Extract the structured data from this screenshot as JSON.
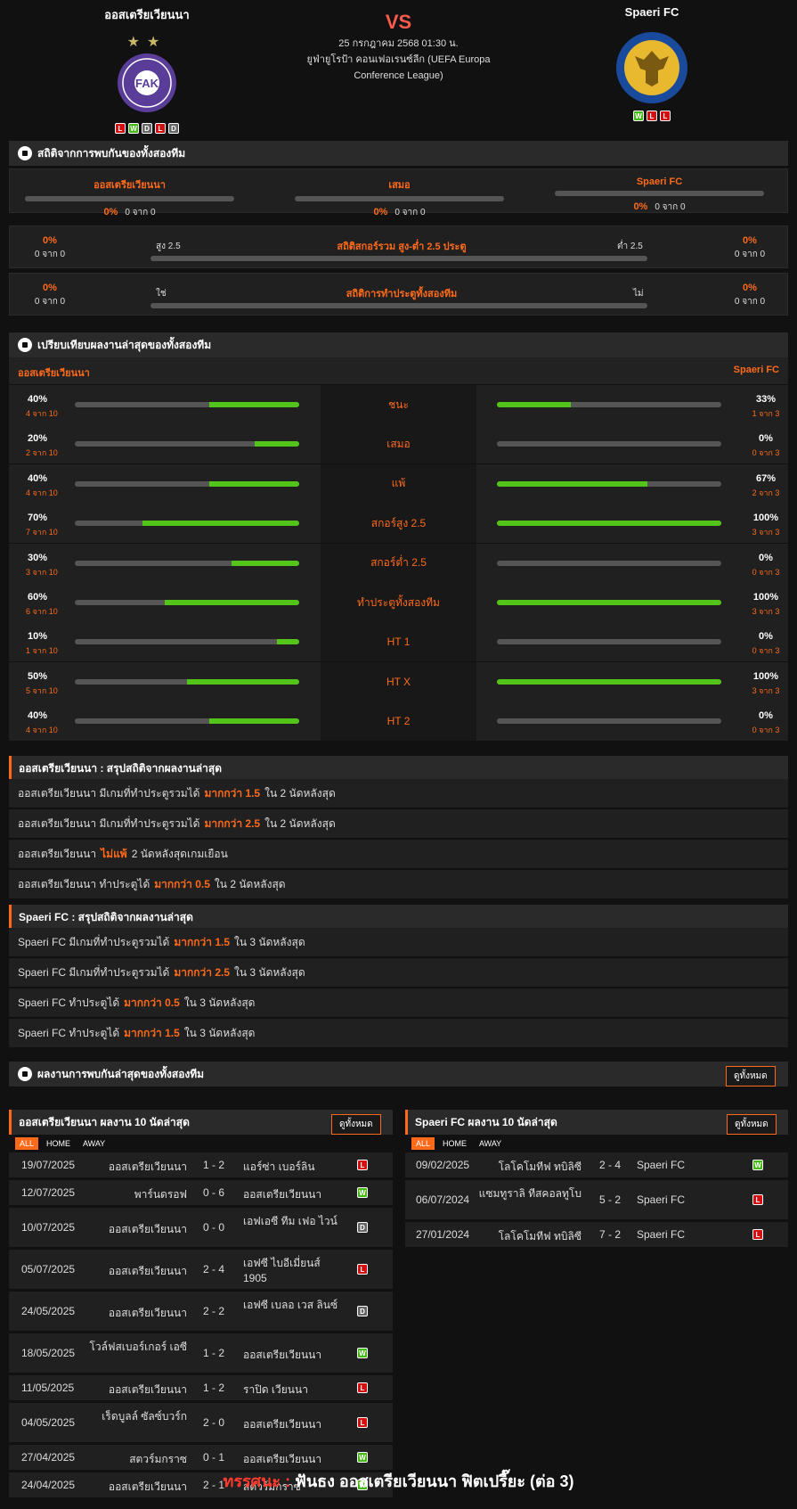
{
  "match": {
    "home": "ออสเตรียเวียนนา",
    "away": "Spaeri FC",
    "vs": "VS",
    "date": "25 กรกฎาคม 2568 01:30 น.",
    "competition": "ยูฟ่ายูโรป้า คอนเฟอเรนซ์ลีก (UEFA Europa Conference League)",
    "home_form": [
      "L",
      "W",
      "D",
      "L",
      "D"
    ],
    "away_form": [
      "W",
      "L",
      "L"
    ]
  },
  "h2h": {
    "title": "สถิติจากการพบกันของทั้งสองทีม",
    "cols": [
      {
        "label": "ออสเตรียเวียนนา",
        "pct": "0%",
        "of": "0 จาก 0"
      },
      {
        "label": "เสมอ",
        "pct": "0%",
        "of": "0 จาก 0"
      },
      {
        "label": "Spaeri FC",
        "pct": "0%",
        "of": "0 จาก 0"
      }
    ],
    "ou": {
      "title": "สถิติสกอร์รวม สูง-ต่ำ 2.5 ประตู",
      "left_label": "สูง 2.5",
      "right_label": "ต่ำ 2.5",
      "lp": "0%",
      "lo": "0 จาก 0",
      "rp": "0%",
      "ro": "0 จาก 0"
    },
    "btts": {
      "title": "สถิติการทำประตูทั้งสองทีม",
      "left_label": "ใช่",
      "right_label": "ไม่",
      "lp": "0%",
      "lo": "0 จาก 0",
      "rp": "0%",
      "ro": "0 จาก 0"
    }
  },
  "compare": {
    "title": "เปรียบเทียบผลงานล่าสุดของทั้งสองทีม",
    "home": "ออสเตรียเวียนนา",
    "away": "Spaeri FC",
    "rows": [
      {
        "label": "ชนะ",
        "hp": "40%",
        "ho": "4 จาก 10",
        "hv": 0.4,
        "ap": "33%",
        "ao": "1 จาก 3",
        "av": 0.33
      },
      {
        "label": "เสมอ",
        "hp": "20%",
        "ho": "2 จาก 10",
        "hv": 0.2,
        "ap": "0%",
        "ao": "0 จาก 3",
        "av": 0
      },
      {
        "label": "แพ้",
        "hp": "40%",
        "ho": "4 จาก 10",
        "hv": 0.4,
        "ap": "67%",
        "ao": "2 จาก 3",
        "av": 0.67
      },
      {
        "label": "สกอร์สูง 2.5",
        "hp": "70%",
        "ho": "7 จาก 10",
        "hv": 0.7,
        "ap": "100%",
        "ao": "3 จาก 3",
        "av": 1
      },
      {
        "label": "สกอร์ต่ำ 2.5",
        "hp": "30%",
        "ho": "3 จาก 10",
        "hv": 0.3,
        "ap": "0%",
        "ao": "0 จาก 3",
        "av": 0
      },
      {
        "label": "ทำประตูทั้งสองทีม",
        "hp": "60%",
        "ho": "6 จาก 10",
        "hv": 0.6,
        "ap": "100%",
        "ao": "3 จาก 3",
        "av": 1
      },
      {
        "label": "HT 1",
        "hp": "10%",
        "ho": "1 จาก 10",
        "hv": 0.1,
        "ap": "0%",
        "ao": "0 จาก 3",
        "av": 0
      },
      {
        "label": "HT X",
        "hp": "50%",
        "ho": "5 จาก 10",
        "hv": 0.5,
        "ap": "100%",
        "ao": "3 จาก 3",
        "av": 1
      },
      {
        "label": "HT 2",
        "hp": "40%",
        "ho": "4 จาก 10",
        "hv": 0.4,
        "ap": "0%",
        "ao": "0 จาก 3",
        "av": 0
      }
    ]
  },
  "summary_home": {
    "title": "ออสเตรียเวียนนา : สรุปสถิติจากผลงานล่าสุด",
    "rows": [
      {
        "a": "ออสเตรียเวียนนา  มีเกมที่ทำประตูรวมได้",
        "h": "มากกว่า  1.5",
        "b": "ใน 2 นัดหลังสุด"
      },
      {
        "a": "ออสเตรียเวียนนา  มีเกมที่ทำประตูรวมได้",
        "h": "มากกว่า  2.5",
        "b": "ใน 2 นัดหลังสุด"
      },
      {
        "a": "ออสเตรียเวียนนา",
        "h": "ไม่แพ้",
        "b": "2  นัดหลังสุดเกมเยือน"
      },
      {
        "a": "ออสเตรียเวียนนา  ทำประตูได้",
        "h": "มากกว่า  0.5",
        "b": "ใน 2 นัดหลังสุด"
      }
    ]
  },
  "summary_away": {
    "title": "Spaeri FC : สรุปสถิติจากผลงานล่าสุด",
    "rows": [
      {
        "a": "Spaeri FC  มีเกมที่ทำประตูรวมได้",
        "h": "มากกว่า  1.5",
        "b": "ใน 3 นัดหลังสุด"
      },
      {
        "a": "Spaeri FC  มีเกมที่ทำประตูรวมได้",
        "h": "มากกว่า  2.5",
        "b": "ใน 3 นัดหลังสุด"
      },
      {
        "a": "Spaeri FC  ทำประตูได้",
        "h": "มากกว่า  0.5",
        "b": "ใน 3 นัดหลังสุด"
      },
      {
        "a": "Spaeri FC  ทำประตูได้",
        "h": "มากกว่า  1.5",
        "b": "ใน 3 นัดหลังสุด"
      }
    ]
  },
  "recent_h2h": {
    "title": "ผลงานการพบกันล่าสุดของทั้งสองทีม",
    "button": "ดูทั้งหมด"
  },
  "home_list": {
    "title": "ออสเตรียเวียนนา ผลงาน 10 นัดล่าสุด",
    "button": "ดูทั้งหมด",
    "tabs": [
      "ALL",
      "HOME",
      "AWAY"
    ],
    "matches": [
      {
        "date": "19/07/2025",
        "home": "ออสเตรียเวียนนา",
        "score": "1 - 2",
        "away": "แอร์ซ่า เบอร์ลิน",
        "res": "L"
      },
      {
        "date": "12/07/2025",
        "home": "พาร์นดรอฟ",
        "score": "0 - 6",
        "away": "ออสเตรียเวียนนา",
        "res": "W"
      },
      {
        "date": "10/07/2025",
        "home": "ออสเตรียเวียนนา",
        "score": "0 - 0",
        "away": "เอฟเอซี ทีม เฟอ ไวน์",
        "res": "D"
      },
      {
        "date": "05/07/2025",
        "home": "ออสเตรียเวียนนา",
        "score": "2 - 4",
        "away": "เอฟซี ไบอีเมี่ยนส์ 1905",
        "res": "L"
      },
      {
        "date": "24/05/2025",
        "home": "ออสเตรียเวียนนา",
        "score": "2 - 2",
        "away": "เอฟซี เบลอ เวส ลินซ์",
        "res": "D"
      },
      {
        "date": "18/05/2025",
        "home": "โวล์ฟสเบอร์เกอร์ เอซี",
        "score": "1 - 2",
        "away": "ออสเตรียเวียนนา",
        "res": "W"
      },
      {
        "date": "11/05/2025",
        "home": "ออสเตรียเวียนนา",
        "score": "1 - 2",
        "away": "ราปิด เวียนนา",
        "res": "L"
      },
      {
        "date": "04/05/2025",
        "home": "เร็ดบูลล์ ซัลซ์บวร์ก",
        "score": "2 - 0",
        "away": "ออสเตรียเวียนนา",
        "res": "L"
      },
      {
        "date": "27/04/2025",
        "home": "สตวร์มกราซ",
        "score": "0 - 1",
        "away": "ออสเตรียเวียนนา",
        "res": "W"
      },
      {
        "date": "24/04/2025",
        "home": "ออสเตรียเวียนนา",
        "score": "2 - 1",
        "away": "สตวร์มกราซ",
        "res": "W"
      }
    ]
  },
  "away_list": {
    "title": "Spaeri FC ผลงาน 10 นัดล่าสุด",
    "button": "ดูทั้งหมด",
    "tabs": [
      "ALL",
      "HOME",
      "AWAY"
    ],
    "matches": [
      {
        "date": "09/02/2025",
        "home": "โลโคโมทีฟ ทบิลิซี",
        "score": "2 - 4",
        "away": "Spaeri FC",
        "res": "W"
      },
      {
        "date": "06/07/2024",
        "home": "แซมทูราลิ ทีสคอลทูโบ",
        "score": "5 - 2",
        "away": "Spaeri FC",
        "res": "L"
      },
      {
        "date": "27/01/2024",
        "home": "โลโคโมทีฟ ทบิลิซี",
        "score": "7 - 2",
        "away": "Spaeri FC",
        "res": "L"
      }
    ]
  },
  "prediction": {
    "label": "ทรรศนะ :",
    "text": "ฟันธง ออสเตรียเวียนนา ฟิตเปรี๊ยะ (ต่อ 3)"
  },
  "colors": {
    "accent": "#ff6a1a",
    "win": "#45b815",
    "loss": "#d40f0f",
    "draw": "#666666",
    "bar": "#52c41a"
  }
}
